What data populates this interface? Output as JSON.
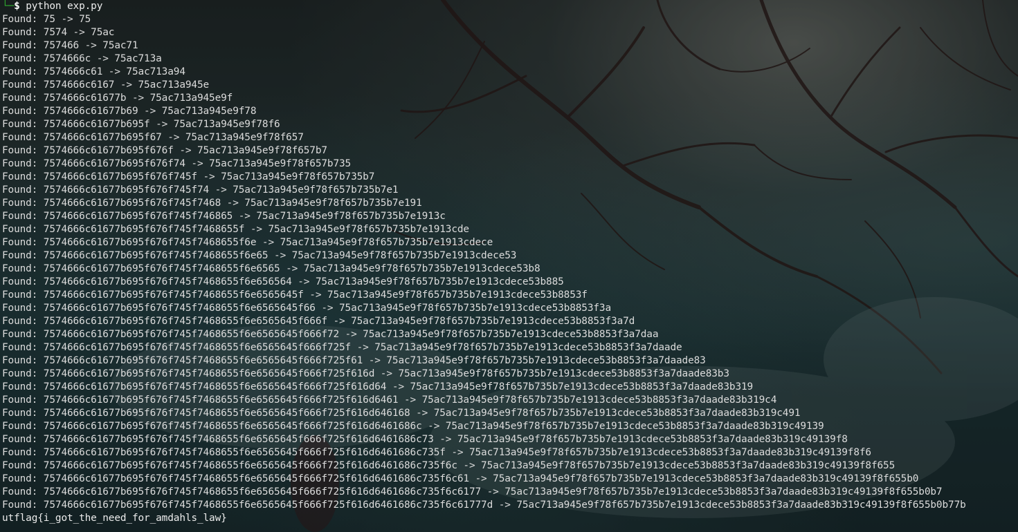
{
  "terminal": {
    "prompt": {
      "corner": "└─",
      "symbol": "$",
      "command": "python exp.py"
    },
    "output": [
      "Found: 75 -> 75",
      "Found: 7574 -> 75ac",
      "Found: 757466 -> 75ac71",
      "Found: 7574666c -> 75ac713a",
      "Found: 7574666c61 -> 75ac713a94",
      "Found: 7574666c6167 -> 75ac713a945e",
      "Found: 7574666c61677b -> 75ac713a945e9f",
      "Found: 7574666c61677b69 -> 75ac713a945e9f78",
      "Found: 7574666c61677b695f -> 75ac713a945e9f78f6",
      "Found: 7574666c61677b695f67 -> 75ac713a945e9f78f657",
      "Found: 7574666c61677b695f676f -> 75ac713a945e9f78f657b7",
      "Found: 7574666c61677b695f676f74 -> 75ac713a945e9f78f657b735",
      "Found: 7574666c61677b695f676f745f -> 75ac713a945e9f78f657b735b7",
      "Found: 7574666c61677b695f676f745f74 -> 75ac713a945e9f78f657b735b7e1",
      "Found: 7574666c61677b695f676f745f7468 -> 75ac713a945e9f78f657b735b7e191",
      "Found: 7574666c61677b695f676f745f746865 -> 75ac713a945e9f78f657b735b7e1913c",
      "Found: 7574666c61677b695f676f745f7468655f -> 75ac713a945e9f78f657b735b7e1913cde",
      "Found: 7574666c61677b695f676f745f7468655f6e -> 75ac713a945e9f78f657b735b7e1913cdece",
      "Found: 7574666c61677b695f676f745f7468655f6e65 -> 75ac713a945e9f78f657b735b7e1913cdece53",
      "Found: 7574666c61677b695f676f745f7468655f6e6565 -> 75ac713a945e9f78f657b735b7e1913cdece53b8",
      "Found: 7574666c61677b695f676f745f7468655f6e656564 -> 75ac713a945e9f78f657b735b7e1913cdece53b885",
      "Found: 7574666c61677b695f676f745f7468655f6e6565645f -> 75ac713a945e9f78f657b735b7e1913cdece53b8853f",
      "Found: 7574666c61677b695f676f745f7468655f6e6565645f66 -> 75ac713a945e9f78f657b735b7e1913cdece53b8853f3a",
      "Found: 7574666c61677b695f676f745f7468655f6e6565645f666f -> 75ac713a945e9f78f657b735b7e1913cdece53b8853f3a7d",
      "Found: 7574666c61677b695f676f745f7468655f6e6565645f666f72 -> 75ac713a945e9f78f657b735b7e1913cdece53b8853f3a7daa",
      "Found: 7574666c61677b695f676f745f7468655f6e6565645f666f725f -> 75ac713a945e9f78f657b735b7e1913cdece53b8853f3a7daade",
      "Found: 7574666c61677b695f676f745f7468655f6e6565645f666f725f61 -> 75ac713a945e9f78f657b735b7e1913cdece53b8853f3a7daade83",
      "Found: 7574666c61677b695f676f745f7468655f6e6565645f666f725f616d -> 75ac713a945e9f78f657b735b7e1913cdece53b8853f3a7daade83b3",
      "Found: 7574666c61677b695f676f745f7468655f6e6565645f666f725f616d64 -> 75ac713a945e9f78f657b735b7e1913cdece53b8853f3a7daade83b319",
      "Found: 7574666c61677b695f676f745f7468655f6e6565645f666f725f616d6461 -> 75ac713a945e9f78f657b735b7e1913cdece53b8853f3a7daade83b319c4",
      "Found: 7574666c61677b695f676f745f7468655f6e6565645f666f725f616d646168 -> 75ac713a945e9f78f657b735b7e1913cdece53b8853f3a7daade83b319c491",
      "Found: 7574666c61677b695f676f745f7468655f6e6565645f666f725f616d6461686c -> 75ac713a945e9f78f657b735b7e1913cdece53b8853f3a7daade83b319c49139",
      "Found: 7574666c61677b695f676f745f7468655f6e6565645f666f725f616d6461686c73 -> 75ac713a945e9f78f657b735b7e1913cdece53b8853f3a7daade83b319c49139f8",
      "Found: 7574666c61677b695f676f745f7468655f6e6565645f666f725f616d6461686c735f -> 75ac713a945e9f78f657b735b7e1913cdece53b8853f3a7daade83b319c49139f8f6",
      "Found: 7574666c61677b695f676f745f7468655f6e6565645f666f725f616d6461686c735f6c -> 75ac713a945e9f78f657b735b7e1913cdece53b8853f3a7daade83b319c49139f8f655",
      "Found: 7574666c61677b695f676f745f7468655f6e6565645f666f725f616d6461686c735f6c61 -> 75ac713a945e9f78f657b735b7e1913cdece53b8853f3a7daade83b319c49139f8f655b0",
      "Found: 7574666c61677b695f676f745f7468655f6e6565645f666f725f616d6461686c735f6c6177 -> 75ac713a945e9f78f657b735b7e1913cdece53b8853f3a7daade83b319c49139f8f655b0b7",
      "Found: 7574666c61677b695f676f745f7468655f6e6565645f666f725f616d6461686c735f6c61777d -> 75ac713a945e9f78f657b735b7e1913cdece53b8853f3a7daade83b319c49139f8f655b0b77b"
    ],
    "flag": "utflag{i_got_the_need_for_amdahls_law}"
  },
  "colors": {
    "prompt_corner": "#2fa82f",
    "text": "#dcdcdc"
  }
}
